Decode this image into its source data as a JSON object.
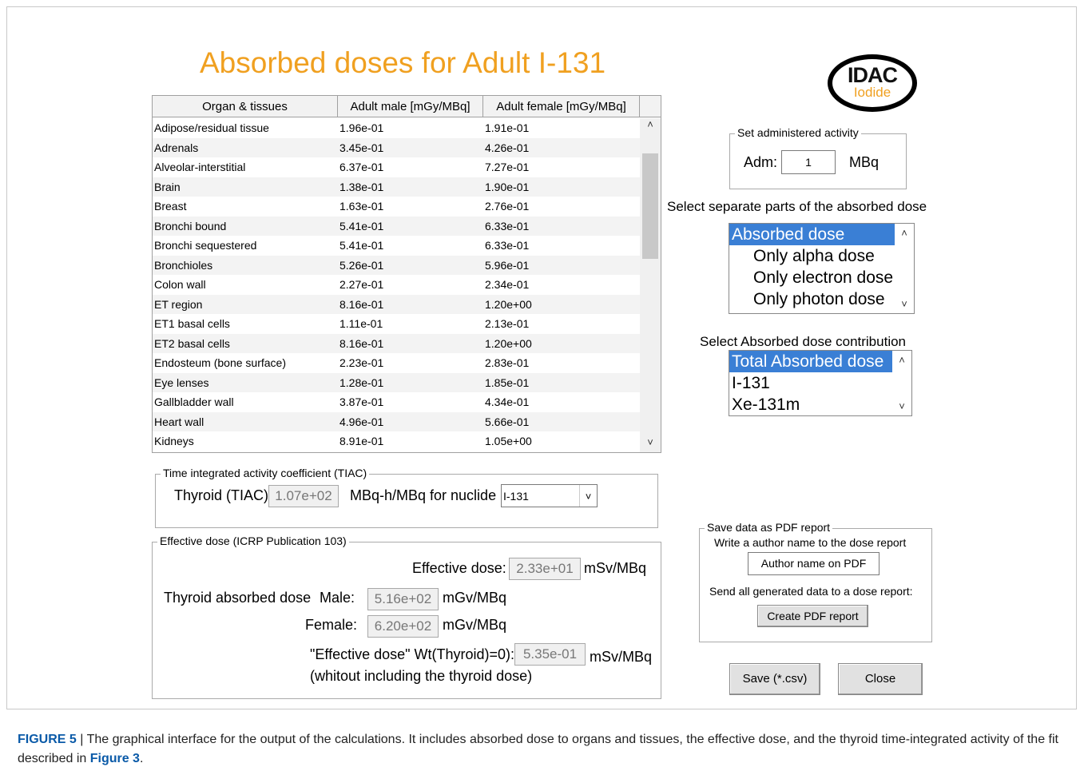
{
  "title": "Absorbed doses for Adult I-131",
  "logo": {
    "line1": "IDAC",
    "line2": "Iodide"
  },
  "table": {
    "headers": [
      "Organ & tissues",
      "Adult male [mGy/MBq]",
      "Adult female [mGy/MBq]"
    ],
    "rows": [
      [
        "Adipose/residual tissue",
        "1.96e-01",
        "1.91e-01"
      ],
      [
        "Adrenals",
        "3.45e-01",
        "4.26e-01"
      ],
      [
        "Alveolar-interstitial",
        "6.37e-01",
        "7.27e-01"
      ],
      [
        "Brain",
        "1.38e-01",
        "1.90e-01"
      ],
      [
        "Breast",
        "1.63e-01",
        "2.76e-01"
      ],
      [
        "Bronchi bound",
        "5.41e-01",
        "6.33e-01"
      ],
      [
        "Bronchi sequestered",
        "5.41e-01",
        "6.33e-01"
      ],
      [
        "Bronchioles",
        "5.26e-01",
        "5.96e-01"
      ],
      [
        "Colon wall",
        "2.27e-01",
        "2.34e-01"
      ],
      [
        "ET region",
        "8.16e-01",
        "1.20e+00"
      ],
      [
        "ET1 basal cells",
        "1.11e-01",
        "2.13e-01"
      ],
      [
        "ET2 basal cells",
        "8.16e-01",
        "1.20e+00"
      ],
      [
        "Endosteum (bone surface)",
        "2.23e-01",
        "2.83e-01"
      ],
      [
        "Eye lenses",
        "1.28e-01",
        "1.85e-01"
      ],
      [
        "Gallbladder wall",
        "3.87e-01",
        "4.34e-01"
      ],
      [
        "Heart wall",
        "4.96e-01",
        "5.66e-01"
      ],
      [
        "Kidneys",
        "8.91e-01",
        "1.05e+00"
      ]
    ]
  },
  "activity": {
    "legend": "Set administered activity",
    "label": "Adm:",
    "value": "1",
    "unit": "MBq"
  },
  "parts": {
    "heading": "Select separate parts of the absorbed dose",
    "items": [
      "Absorbed dose",
      "Only alpha dose",
      "Only electron dose",
      "Only photon dose"
    ]
  },
  "contribution": {
    "heading": "Select Absorbed dose contribution",
    "items": [
      "Total Absorbed dose",
      "I-131",
      "Xe-131m"
    ]
  },
  "tiac": {
    "legend": "Time integrated activity coefficient (TIAC)",
    "label": "Thyroid (TIAC)",
    "value": "1.07e+02",
    "unit": "MBq-h/MBq  for nuclide",
    "nuclide": "I-131"
  },
  "effective": {
    "legend": "Effective dose (ICRP Publication 103)",
    "eff_label": "Effective dose:",
    "eff_value": "2.33e+01",
    "eff_unit": "mSv/MBq",
    "thy_label": "Thyroid absorbed dose",
    "male_label": "Male:",
    "male_value": "5.16e+02",
    "male_unit": "mGv/MBq",
    "female_label": "Female:",
    "female_value": "6.20e+02",
    "female_unit": "mGv/MBq",
    "wt_label": "\"Effective dose\" Wt(Thyroid)=0):",
    "wt_value": "5.35e-01",
    "wt_unit": "mSv/MBq",
    "wt_note": "(whitout including the thyroid dose)"
  },
  "pdf": {
    "legend": "Save data as PDF report",
    "author_prompt": "Write a author name to the dose report",
    "author_value": "Author name on PDF",
    "send_label": "Send all generated data to a dose report:",
    "create_button": "Create PDF report"
  },
  "buttons": {
    "save": "Save (*.csv)",
    "close": "Close"
  },
  "caption": {
    "label": "FIGURE 5",
    "sep": " | ",
    "text": "The graphical interface for the output of the calculations. It includes absorbed dose to organs and tissues, the effective dose, and the thyroid time-integrated activity of the fit described in ",
    "ref": "Figure 3",
    "end": "."
  }
}
